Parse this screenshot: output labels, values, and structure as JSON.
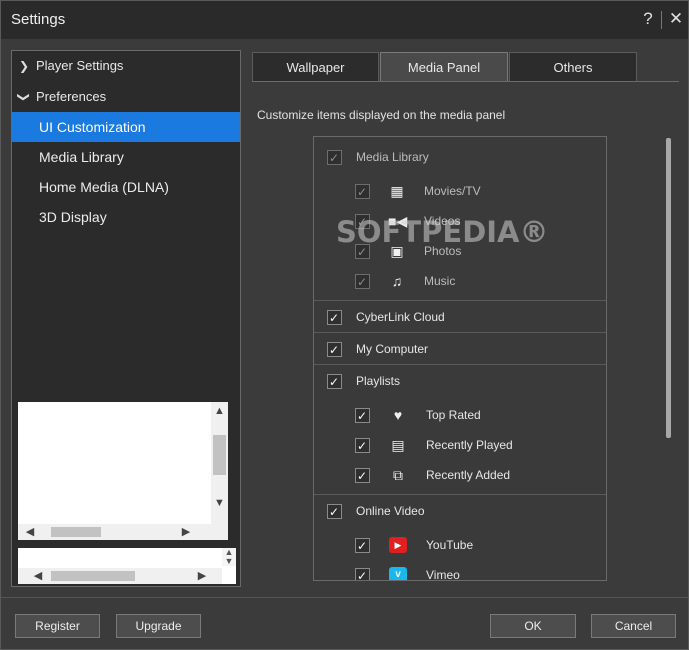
{
  "window": {
    "title": "Settings",
    "help_label": "?",
    "close_label": "✕"
  },
  "sidebar": {
    "groups": [
      {
        "label": "Player Settings",
        "expanded": false
      },
      {
        "label": "Preferences",
        "expanded": true
      }
    ],
    "items": [
      {
        "label": "UI Customization",
        "selected": true
      },
      {
        "label": "Media Library",
        "selected": false
      },
      {
        "label": "Home Media (DLNA)",
        "selected": false
      },
      {
        "label": "3D Display",
        "selected": false
      }
    ]
  },
  "tabs": [
    {
      "label": "Wallpaper",
      "active": false
    },
    {
      "label": "Media Panel",
      "active": true
    },
    {
      "label": "Others",
      "active": false
    }
  ],
  "media_panel": {
    "description": "Customize items displayed on the media panel",
    "items": [
      {
        "label": "Media Library",
        "checked": true,
        "enabled": false,
        "icon": "",
        "level": 0
      },
      {
        "label": "Movies/TV",
        "checked": true,
        "enabled": false,
        "icon": "film-icon",
        "level": 1
      },
      {
        "label": "Videos",
        "checked": true,
        "enabled": false,
        "icon": "video-camera-icon",
        "level": 1
      },
      {
        "label": "Photos",
        "checked": true,
        "enabled": false,
        "icon": "photo-icon",
        "level": 1
      },
      {
        "label": "Music",
        "checked": true,
        "enabled": false,
        "icon": "music-note-icon",
        "level": 1
      },
      {
        "label": "CyberLink Cloud",
        "checked": true,
        "enabled": true,
        "icon": "",
        "level": 0
      },
      {
        "label": "My Computer",
        "checked": true,
        "enabled": true,
        "icon": "",
        "level": 0
      },
      {
        "label": "Playlists",
        "checked": true,
        "enabled": true,
        "icon": "",
        "level": 0
      },
      {
        "label": "Top Rated",
        "checked": true,
        "enabled": true,
        "icon": "heart-icon",
        "level": 1
      },
      {
        "label": "Recently Played",
        "checked": true,
        "enabled": true,
        "icon": "recent-play-icon",
        "level": 1
      },
      {
        "label": "Recently Added",
        "checked": true,
        "enabled": true,
        "icon": "recent-add-icon",
        "level": 1
      },
      {
        "label": "Online Video",
        "checked": true,
        "enabled": true,
        "icon": "",
        "level": 0
      },
      {
        "label": "YouTube",
        "checked": true,
        "enabled": true,
        "icon": "youtube-icon",
        "level": 1
      },
      {
        "label": "Vimeo",
        "checked": true,
        "enabled": true,
        "icon": "vimeo-icon",
        "level": 1
      }
    ]
  },
  "watermark": "SOFTPEDIA®",
  "buttons": {
    "register": "Register",
    "upgrade": "Upgrade",
    "ok": "OK",
    "cancel": "Cancel"
  },
  "colors": {
    "selection": "#1a7ae0",
    "background": "#3b3b3b",
    "panel": "#2b2b2b"
  }
}
